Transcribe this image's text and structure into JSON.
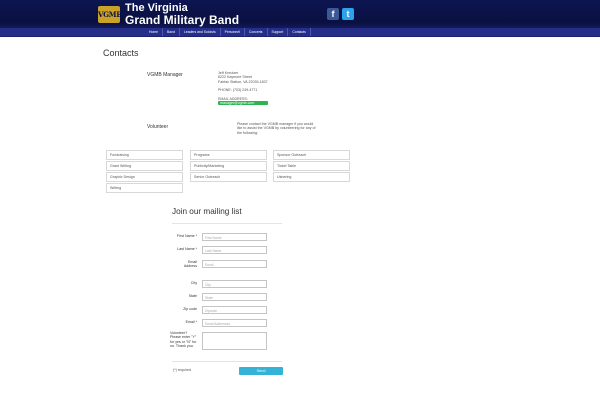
{
  "header": {
    "logo_text": "VGMB",
    "title_line1": "The Virginia",
    "title_line2": "Grand Military Band",
    "social": [
      {
        "icon": "facebook-icon",
        "glyph": "f"
      },
      {
        "icon": "twitter-icon",
        "glyph": "t"
      }
    ],
    "colors": {
      "bar": "#0a1040",
      "nav": "#252f8a"
    }
  },
  "nav": [
    "Home",
    "Band",
    "Leaders and Soloists",
    "Personnel",
    "Concerts",
    "Support",
    "Contacts"
  ],
  "page_title": "Contacts",
  "manager": {
    "label": "VGMB Manager",
    "name": "Jeff Kreutzer",
    "street": "6222 Kaymore Street",
    "city": "Fairfax Station, VA 22039-1837",
    "phone": "PHONE: (703) 249-4771",
    "email_label": "EMAIL ADDRESS:",
    "email": "manager@vgmb.com"
  },
  "volunteer": {
    "label": "Volunteer",
    "text": "Please contact the VGMB manager if you would like to assist the VGMB by volunteering for any of the following:",
    "columns": [
      [
        "Fundraising",
        "Grant Writing",
        "Graphic Design",
        "Writing"
      ],
      [
        "Programs",
        "Publicity/Marketing",
        "Senior Outreach"
      ],
      [
        "Sponsor Outreach",
        "Ticket Table",
        "Ushering"
      ]
    ]
  },
  "mailing": {
    "title": "Join our mailing list",
    "fields": [
      {
        "label": "First Name *",
        "placeholder": "First Name"
      },
      {
        "label": "Last Name *",
        "placeholder": "Last Name"
      },
      {
        "label": "Email Address",
        "placeholder": "Email"
      },
      {
        "label": "City",
        "placeholder": "City"
      },
      {
        "label": "State",
        "placeholder": "State"
      },
      {
        "label": "Zip code",
        "placeholder": "Zipcode"
      },
      {
        "label": "Email *",
        "placeholder": "Email Addresses"
      }
    ],
    "volunteer_question": "Volunteer? Please enter \"Y\" for yes or \"N\" for no. Thank you.",
    "required_note": "(*) required",
    "send_label": "Send"
  }
}
